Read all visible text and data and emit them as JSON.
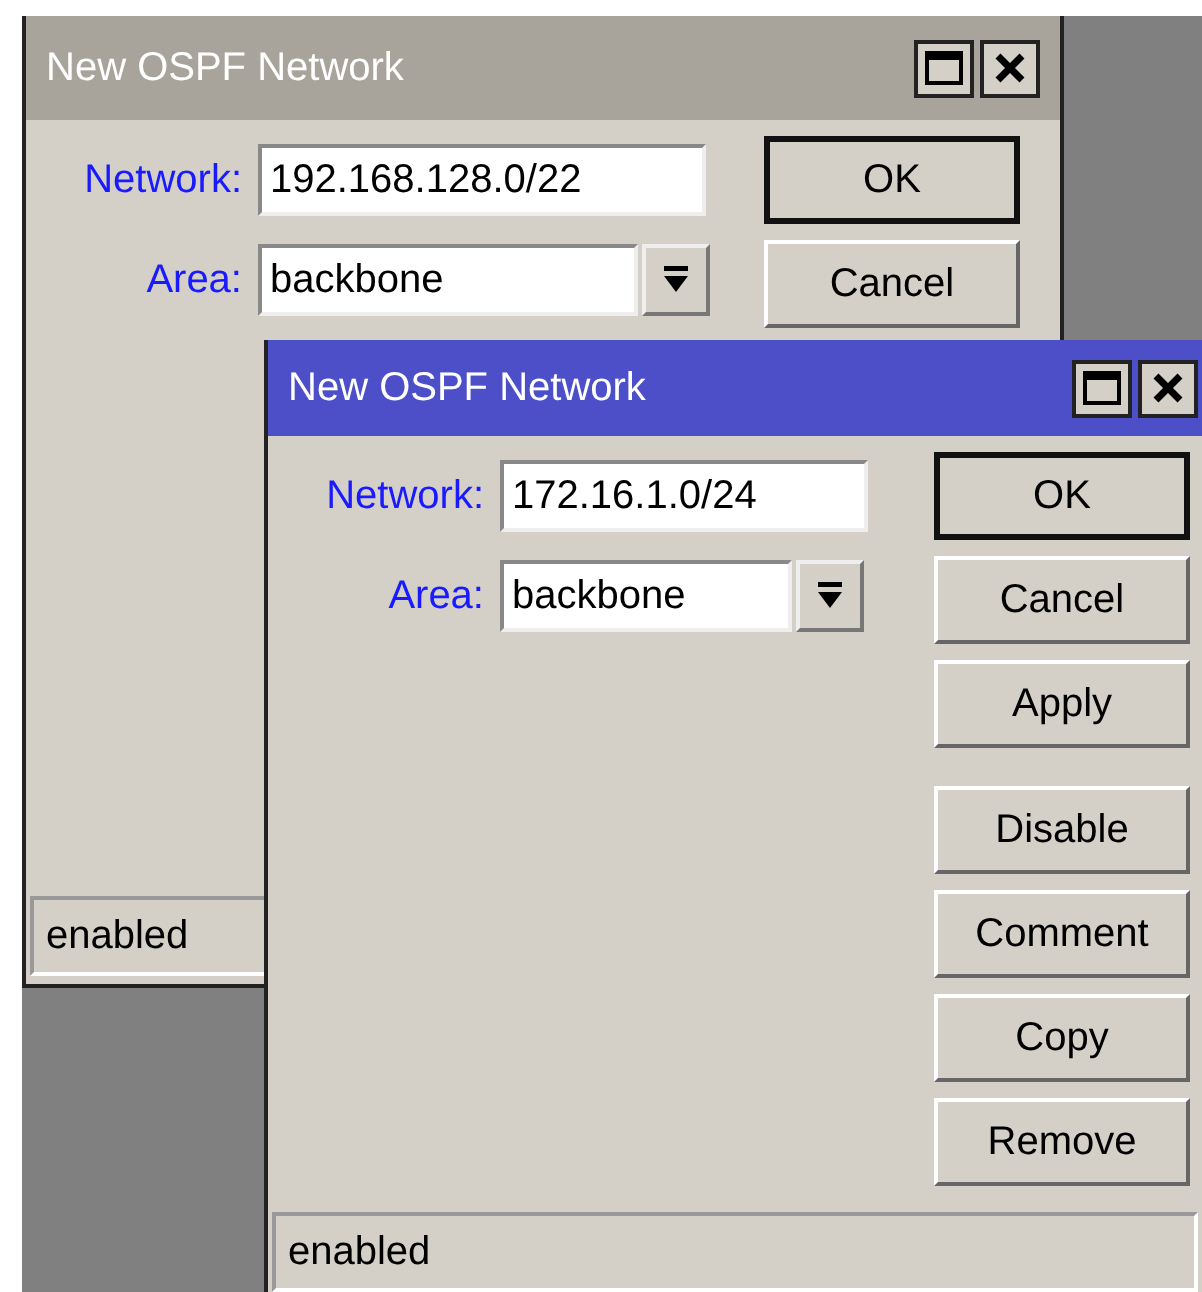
{
  "windows": [
    {
      "title": "New OSPF Network",
      "active": false,
      "fields": [
        {
          "label": "Network:",
          "value": "192.168.128.0/22",
          "kind": "text"
        },
        {
          "label": "Area:",
          "value": "backbone",
          "kind": "dropdown"
        }
      ],
      "button_groups": [
        [
          {
            "label": "OK",
            "default": true
          },
          {
            "label": "Cancel",
            "default": false
          }
        ]
      ],
      "status": "enabled"
    },
    {
      "title": "New OSPF Network",
      "active": true,
      "fields": [
        {
          "label": "Network:",
          "value": "172.16.1.0/24",
          "kind": "text"
        },
        {
          "label": "Area:",
          "value": "backbone",
          "kind": "dropdown"
        }
      ],
      "button_groups": [
        [
          {
            "label": "OK",
            "default": true
          },
          {
            "label": "Cancel",
            "default": false
          },
          {
            "label": "Apply",
            "default": false
          }
        ],
        [
          {
            "label": "Disable",
            "default": false
          },
          {
            "label": "Comment",
            "default": false
          },
          {
            "label": "Copy",
            "default": false
          },
          {
            "label": "Remove",
            "default": false
          }
        ]
      ],
      "status": "enabled"
    }
  ]
}
